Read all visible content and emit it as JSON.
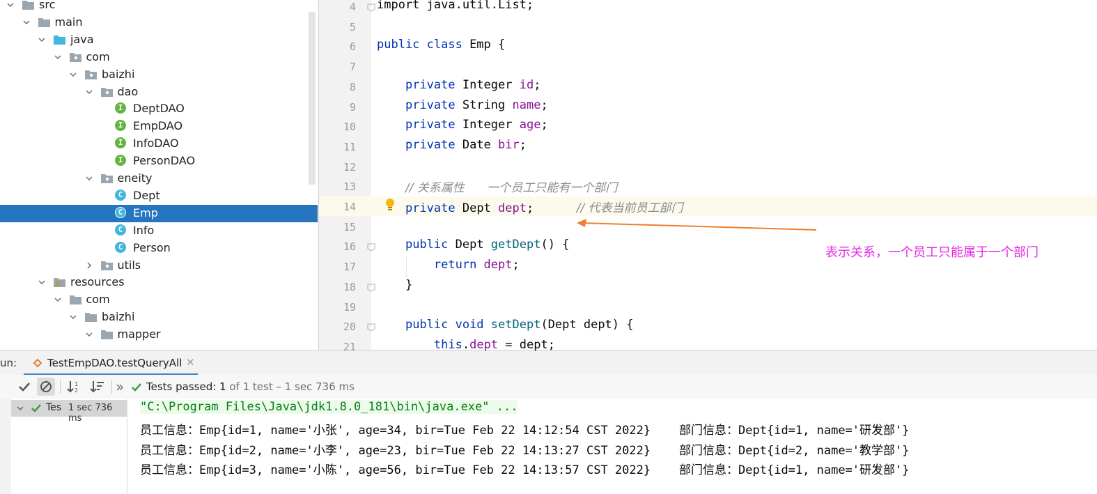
{
  "project_tree": {
    "items": [
      {
        "label": "src",
        "kind": "folder",
        "depth": 0,
        "expanded": true
      },
      {
        "label": "main",
        "kind": "folder",
        "depth": 1,
        "expanded": true
      },
      {
        "label": "java",
        "kind": "source-folder",
        "depth": 2,
        "expanded": true
      },
      {
        "label": "com",
        "kind": "package",
        "depth": 3,
        "expanded": true
      },
      {
        "label": "baizhi",
        "kind": "package",
        "depth": 4,
        "expanded": true
      },
      {
        "label": "dao",
        "kind": "package",
        "depth": 5,
        "expanded": true
      },
      {
        "label": "DeptDAO",
        "kind": "interface",
        "depth": 6
      },
      {
        "label": "EmpDAO",
        "kind": "interface",
        "depth": 6
      },
      {
        "label": "InfoDAO",
        "kind": "interface",
        "depth": 6
      },
      {
        "label": "PersonDAO",
        "kind": "interface",
        "depth": 6
      },
      {
        "label": "eneity",
        "kind": "package",
        "depth": 5,
        "expanded": true
      },
      {
        "label": "Dept",
        "kind": "class",
        "depth": 6
      },
      {
        "label": "Emp",
        "kind": "class",
        "depth": 6,
        "selected": true
      },
      {
        "label": "Info",
        "kind": "class",
        "depth": 6
      },
      {
        "label": "Person",
        "kind": "class",
        "depth": 6
      },
      {
        "label": "utils",
        "kind": "package",
        "depth": 5,
        "expanded": false
      },
      {
        "label": "resources",
        "kind": "resource-folder",
        "depth": 2,
        "expanded": true
      },
      {
        "label": "com",
        "kind": "folder",
        "depth": 3,
        "expanded": true
      },
      {
        "label": "baizhi",
        "kind": "folder",
        "depth": 4,
        "expanded": true
      },
      {
        "label": "mapper",
        "kind": "folder",
        "depth": 5,
        "expanded": true
      }
    ],
    "badge_interface": "I",
    "badge_class": "C"
  },
  "editor": {
    "lines": [
      {
        "n": "4",
        "tokens": [
          [
            "kw-plain",
            "import java.util.List;"
          ]
        ]
      },
      {
        "n": "5",
        "tokens": []
      },
      {
        "n": "6",
        "tokens": [
          [
            "kw",
            "public class "
          ],
          [
            "plain",
            "Emp {"
          ]
        ]
      },
      {
        "n": "7",
        "tokens": []
      },
      {
        "n": "8",
        "tokens": [
          [
            "plain",
            "    "
          ],
          [
            "kw",
            "private "
          ],
          [
            "plain",
            "Integer "
          ],
          [
            "fld",
            "id"
          ],
          [
            "plain",
            ";"
          ]
        ]
      },
      {
        "n": "9",
        "tokens": [
          [
            "plain",
            "    "
          ],
          [
            "kw",
            "private "
          ],
          [
            "plain",
            "String "
          ],
          [
            "fld",
            "name"
          ],
          [
            "plain",
            ";"
          ]
        ]
      },
      {
        "n": "10",
        "tokens": [
          [
            "plain",
            "    "
          ],
          [
            "kw",
            "private "
          ],
          [
            "plain",
            "Integer "
          ],
          [
            "fld",
            "age"
          ],
          [
            "plain",
            ";"
          ]
        ]
      },
      {
        "n": "11",
        "tokens": [
          [
            "plain",
            "    "
          ],
          [
            "kw",
            "private "
          ],
          [
            "plain",
            "Date "
          ],
          [
            "fld",
            "bir"
          ],
          [
            "plain",
            ";"
          ]
        ]
      },
      {
        "n": "12",
        "tokens": []
      },
      {
        "n": "13",
        "tokens": [
          [
            "plain",
            "    "
          ],
          [
            "cmt",
            "// 关系属性      一个员工只能有一个部门"
          ]
        ]
      },
      {
        "n": "14",
        "tokens": [
          [
            "plain",
            "    "
          ],
          [
            "kw",
            "private "
          ],
          [
            "plain",
            "Dept "
          ],
          [
            "fld",
            "dept"
          ],
          [
            "plain",
            ";      "
          ],
          [
            "cmt",
            "// 代表当前员工部门"
          ]
        ]
      },
      {
        "n": "15",
        "tokens": []
      },
      {
        "n": "16",
        "tokens": [
          [
            "plain",
            "    "
          ],
          [
            "kw",
            "public "
          ],
          [
            "plain",
            "Dept "
          ],
          [
            "mth",
            "getDept"
          ],
          [
            "plain",
            "() {"
          ]
        ]
      },
      {
        "n": "17",
        "tokens": [
          [
            "plain",
            "        "
          ],
          [
            "kw",
            "return "
          ],
          [
            "fld",
            "dept"
          ],
          [
            "plain",
            ";"
          ]
        ]
      },
      {
        "n": "18",
        "tokens": [
          [
            "plain",
            "    }"
          ]
        ]
      },
      {
        "n": "19",
        "tokens": []
      },
      {
        "n": "20",
        "tokens": [
          [
            "plain",
            "    "
          ],
          [
            "kw",
            "public void "
          ],
          [
            "mth",
            "setDept"
          ],
          [
            "plain",
            "(Dept dept) {"
          ]
        ]
      },
      {
        "n": "21",
        "tokens": [
          [
            "plain",
            "        "
          ],
          [
            "kw",
            "this"
          ],
          [
            "plain",
            "."
          ],
          [
            "fld",
            "dept"
          ],
          [
            "plain",
            " = dept;"
          ]
        ]
      }
    ],
    "annotation": "表示关系，一个员工只能属于一个部门",
    "annotation_color": "#e328e3",
    "arrow_color": "#f07d30"
  },
  "run_panel": {
    "label": "un:",
    "tab_title": "TestEmpDAO.testQueryAll",
    "tab_close": "✕",
    "status_main": "Tests passed: 1",
    "status_detail": " of 1 test – 1 sec 736 ms",
    "test_name": "Tes",
    "test_time": "1 sec 736 ms",
    "console": [
      "\"C:\\Program Files\\Java\\jdk1.8.0_181\\bin\\java.exe\" ...",
      "员工信息：Emp{id=1, name='小张', age=34, bir=Tue Feb 22 14:12:54 CST 2022}    部门信息：Dept{id=1, name='研发部'}",
      "员工信息：Emp{id=2, name='小李', age=23, bir=Tue Feb 22 14:13:27 CST 2022}    部门信息：Dept{id=2, name='教学部'}",
      "员工信息：Emp{id=3, name='小陈', age=56, bir=Tue Feb 22 14:13:57 CST 2022}    部门信息：Dept{id=1, name='研发部'}"
    ],
    "accent_pass": "#3d9e3d"
  }
}
